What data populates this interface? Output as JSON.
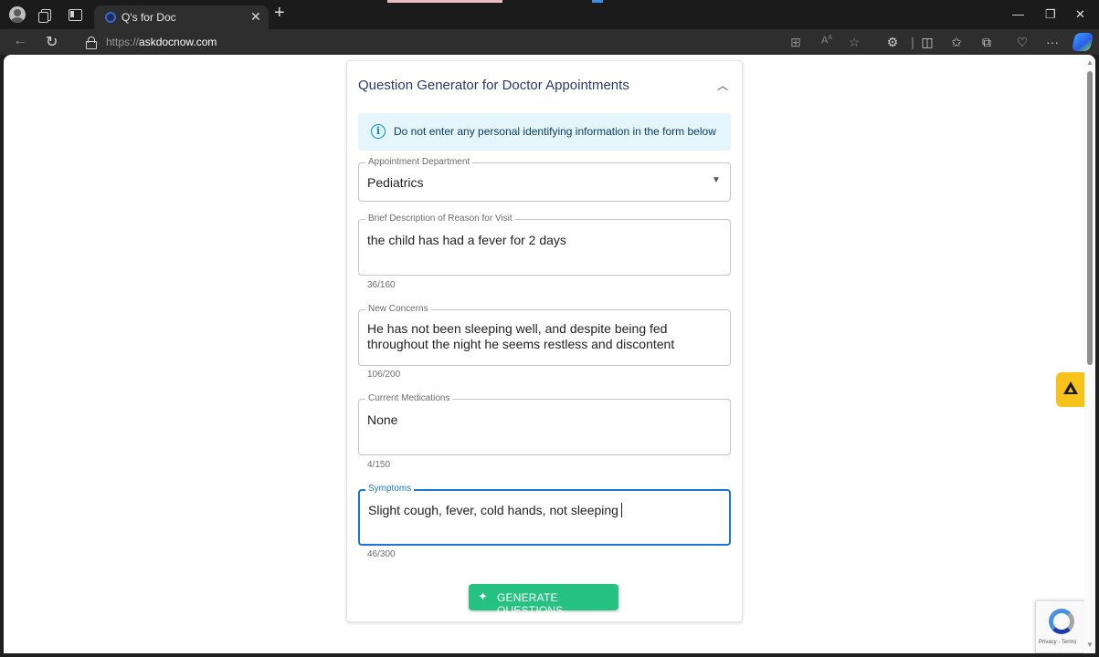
{
  "browser": {
    "tab_title": "Q's for Doc",
    "url_scheme": "https://",
    "url_domain": "askdocnow.com"
  },
  "form": {
    "title": "Question Generator for Doctor Appointments",
    "alert": "Do not enter any personal identifying information in the form below",
    "department": {
      "label": "Appointment Department",
      "value": "Pediatrics"
    },
    "reason": {
      "label": "Brief Description of Reason for Visit",
      "value": "the child has had a fever for 2 days",
      "counter": "36/160"
    },
    "concerns": {
      "label": "New Concerns",
      "value": "He has not been sleeping well, and despite being fed throughout the night he seems restless and discontent",
      "counter": "106/200"
    },
    "medications": {
      "label": "Current Medications",
      "value": "None",
      "counter": "4/150"
    },
    "symptoms": {
      "label": "Symptoms",
      "value": "Slight cough, fever, cold hands, not sleeping",
      "counter": "46/300"
    },
    "submit_label": "GENERATE QUESTIONS"
  },
  "recaptcha": {
    "text": "Privacy - Terms"
  },
  "colors": {
    "accent_button": "#26c281",
    "focus": "#1976d2",
    "alert_bg": "#e5f5fc"
  }
}
